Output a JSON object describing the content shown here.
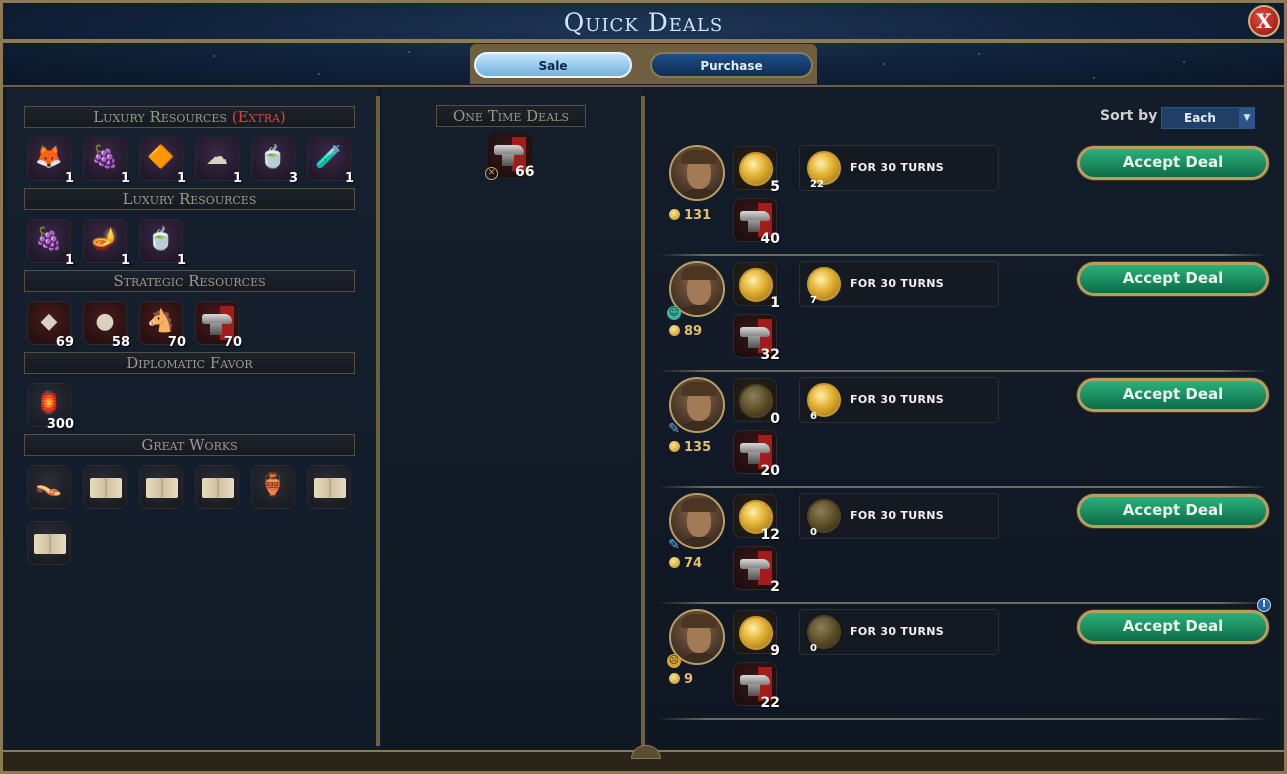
{
  "header": {
    "title": "Quick Deals",
    "close_label": "X"
  },
  "tabs": [
    {
      "label": "Sale",
      "active": true
    },
    {
      "label": "Purchase",
      "active": false
    }
  ],
  "left": {
    "luxury_extra": {
      "title": "Luxury Resources",
      "title_extra": "(Extra)",
      "items": [
        {
          "icon": "fox-icon",
          "glyph": "🦊",
          "qty": "1"
        },
        {
          "icon": "grapes-icon",
          "glyph": "🍇",
          "qty": "1"
        },
        {
          "icon": "amber-icon",
          "glyph": "🔶",
          "qty": "1"
        },
        {
          "icon": "cotton-icon",
          "glyph": "☁",
          "qty": "1"
        },
        {
          "icon": "tea-icon",
          "glyph": "🍵",
          "qty": "3"
        },
        {
          "icon": "perfume-icon",
          "glyph": "🧪",
          "qty": "1"
        }
      ]
    },
    "luxury": {
      "title": "Luxury Resources",
      "items": [
        {
          "icon": "grapes-icon",
          "glyph": "🍇",
          "qty": "1"
        },
        {
          "icon": "incense-icon",
          "glyph": "🪔",
          "qty": "1"
        },
        {
          "icon": "tea-icon",
          "glyph": "🍵",
          "qty": "1"
        }
      ]
    },
    "strategic": {
      "title": "Strategic Resources",
      "items": [
        {
          "icon": "coal-icon",
          "glyph": "◆",
          "qty": "69"
        },
        {
          "icon": "stone-icon",
          "glyph": "●",
          "qty": "58"
        },
        {
          "icon": "horse-icon",
          "glyph": "🐴",
          "qty": "70"
        },
        {
          "icon": "iron-anvil-icon",
          "glyph": "",
          "qty": "70"
        }
      ]
    },
    "diplomatic": {
      "title": "Diplomatic Favor",
      "items": [
        {
          "icon": "favor-lamp-icon",
          "glyph": "🏮",
          "qty": "300"
        }
      ]
    },
    "great_works": {
      "title": "Great Works",
      "items": [
        {
          "icon": "sandals-artifact-icon",
          "glyph": "👡"
        },
        {
          "icon": "book-icon",
          "glyph": ""
        },
        {
          "icon": "book-icon",
          "glyph": ""
        },
        {
          "icon": "book-icon",
          "glyph": ""
        },
        {
          "icon": "pot-artifact-icon",
          "glyph": "🏺"
        },
        {
          "icon": "book-icon",
          "glyph": ""
        },
        {
          "icon": "book-icon",
          "glyph": ""
        }
      ]
    }
  },
  "middle": {
    "title": "One Time Deals",
    "item": {
      "icon": "iron-anvil-icon",
      "qty": "66"
    }
  },
  "right": {
    "sort_label": "Sort by",
    "sort_value": "Each",
    "deals": [
      {
        "mood": "neutral",
        "gold": "131",
        "coin_qty": "5",
        "coin_active": true,
        "strat_qty": "40",
        "per_turn": "22",
        "per_turn_active": true,
        "turns_label": "FOR 30 TURNS",
        "accept_label": "Accept Deal",
        "badge": ""
      },
      {
        "mood": "happy",
        "gold": "89",
        "coin_qty": "1",
        "coin_active": true,
        "strat_qty": "32",
        "per_turn": "7",
        "per_turn_active": true,
        "turns_label": "FOR 30 TURNS",
        "accept_label": "Accept Deal",
        "badge": ""
      },
      {
        "mood": "spy",
        "gold": "135",
        "coin_qty": "0",
        "coin_active": false,
        "strat_qty": "20",
        "per_turn": "6",
        "per_turn_active": true,
        "turns_label": "FOR 30 TURNS",
        "accept_label": "Accept Deal",
        "badge": ""
      },
      {
        "mood": "spy",
        "gold": "74",
        "coin_qty": "12",
        "coin_active": true,
        "strat_qty": "2",
        "per_turn": "0",
        "per_turn_active": false,
        "turns_label": "FOR 30 TURNS",
        "accept_label": "Accept Deal",
        "badge": ""
      },
      {
        "mood": "unhappy",
        "gold": "9",
        "coin_qty": "9",
        "coin_active": true,
        "strat_qty": "22",
        "per_turn": "0",
        "per_turn_active": false,
        "turns_label": "FOR 30 TURNS",
        "accept_label": "Accept Deal",
        "badge": "!"
      }
    ]
  }
}
